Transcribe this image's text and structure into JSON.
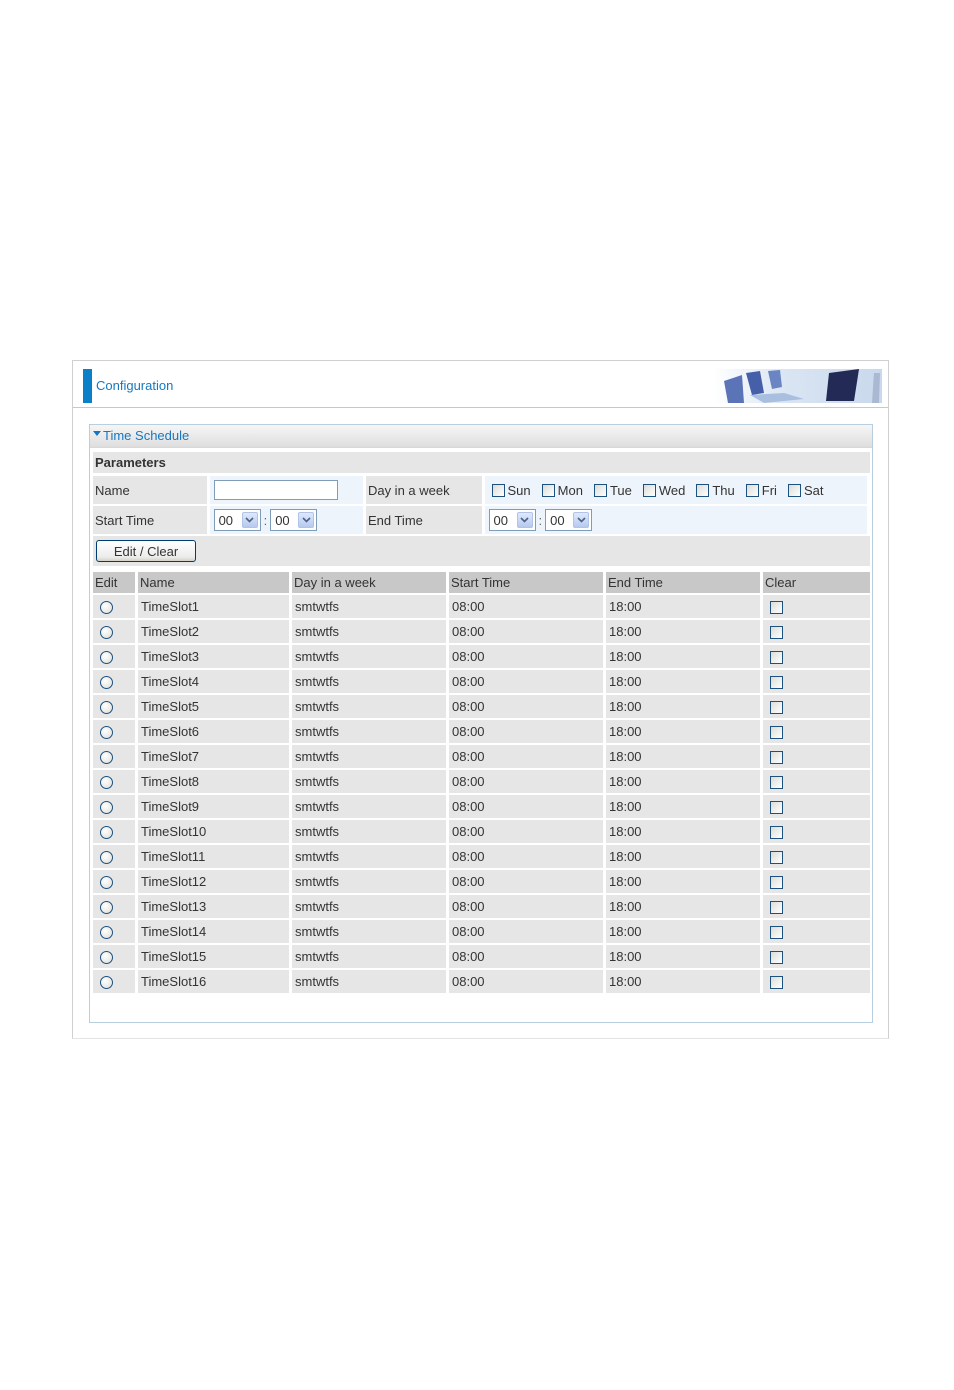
{
  "header": {
    "title": "Configuration"
  },
  "panel": {
    "title": "Time Schedule"
  },
  "parameters": {
    "section_label": "Parameters",
    "name_label": "Name",
    "name_value": "",
    "day_label": "Day in a week",
    "days": [
      "Sun",
      "Mon",
      "Tue",
      "Wed",
      "Thu",
      "Fri",
      "Sat"
    ],
    "start_label": "Start Time",
    "start_hour": "00",
    "start_minute": "00",
    "end_label": "End Time",
    "end_hour": "00",
    "end_minute": "00",
    "colon": ":",
    "edit_clear_label": "Edit / Clear"
  },
  "table": {
    "headers": [
      "Edit",
      "Name",
      "Day in a week",
      "Start Time",
      "End Time",
      "Clear"
    ],
    "rows": [
      {
        "name": "TimeSlot1",
        "days": "smtwtfs",
        "start": "08:00",
        "end": "18:00"
      },
      {
        "name": "TimeSlot2",
        "days": "smtwtfs",
        "start": "08:00",
        "end": "18:00"
      },
      {
        "name": "TimeSlot3",
        "days": "smtwtfs",
        "start": "08:00",
        "end": "18:00"
      },
      {
        "name": "TimeSlot4",
        "days": "smtwtfs",
        "start": "08:00",
        "end": "18:00"
      },
      {
        "name": "TimeSlot5",
        "days": "smtwtfs",
        "start": "08:00",
        "end": "18:00"
      },
      {
        "name": "TimeSlot6",
        "days": "smtwtfs",
        "start": "08:00",
        "end": "18:00"
      },
      {
        "name": "TimeSlot7",
        "days": "smtwtfs",
        "start": "08:00",
        "end": "18:00"
      },
      {
        "name": "TimeSlot8",
        "days": "smtwtfs",
        "start": "08:00",
        "end": "18:00"
      },
      {
        "name": "TimeSlot9",
        "days": "smtwtfs",
        "start": "08:00",
        "end": "18:00"
      },
      {
        "name": "TimeSlot10",
        "days": "smtwtfs",
        "start": "08:00",
        "end": "18:00"
      },
      {
        "name": "TimeSlot11",
        "days": "smtwtfs",
        "start": "08:00",
        "end": "18:00"
      },
      {
        "name": "TimeSlot12",
        "days": "smtwtfs",
        "start": "08:00",
        "end": "18:00"
      },
      {
        "name": "TimeSlot13",
        "days": "smtwtfs",
        "start": "08:00",
        "end": "18:00"
      },
      {
        "name": "TimeSlot14",
        "days": "smtwtfs",
        "start": "08:00",
        "end": "18:00"
      },
      {
        "name": "TimeSlot15",
        "days": "smtwtfs",
        "start": "08:00",
        "end": "18:00"
      },
      {
        "name": "TimeSlot16",
        "days": "smtwtfs",
        "start": "08:00",
        "end": "18:00"
      }
    ]
  }
}
